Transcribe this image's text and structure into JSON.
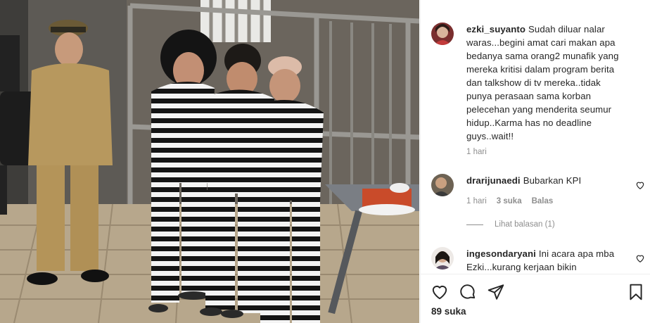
{
  "post": {
    "caption": {
      "username": "ezki_suyanto",
      "text": "Sudah diluar nalar waras...begini amat cari makan apa bedanya sama orang2 munafik yang mereka kritisi dalam program berita dan talkshow di tv mereka..tidak punya perasaan sama korban pelecehan yang menderita seumur hidup..Karma has no deadline guys..wait!!",
      "time": "1 hari"
    },
    "comments": [
      {
        "username": "drarijunaedi",
        "text": "Bubarkan KPI",
        "time": "1 hari",
        "likes": "3 suka",
        "reply_label": "Balas",
        "view_replies": "Lihat balasan (1)"
      },
      {
        "username": "ingesondaryani",
        "text": "Ini acara apa mba Ezki...kurang kerjaan bikin"
      }
    ],
    "like_count": "89 suka"
  },
  "icons": {
    "like": "heart-icon",
    "comment": "comment-icon",
    "share": "paper-plane-icon",
    "save": "bookmark-icon",
    "comment_like": "heart-outline-icon"
  },
  "colors": {
    "text": "#262626",
    "muted": "#8e8e8e",
    "divider": "#efefef"
  }
}
